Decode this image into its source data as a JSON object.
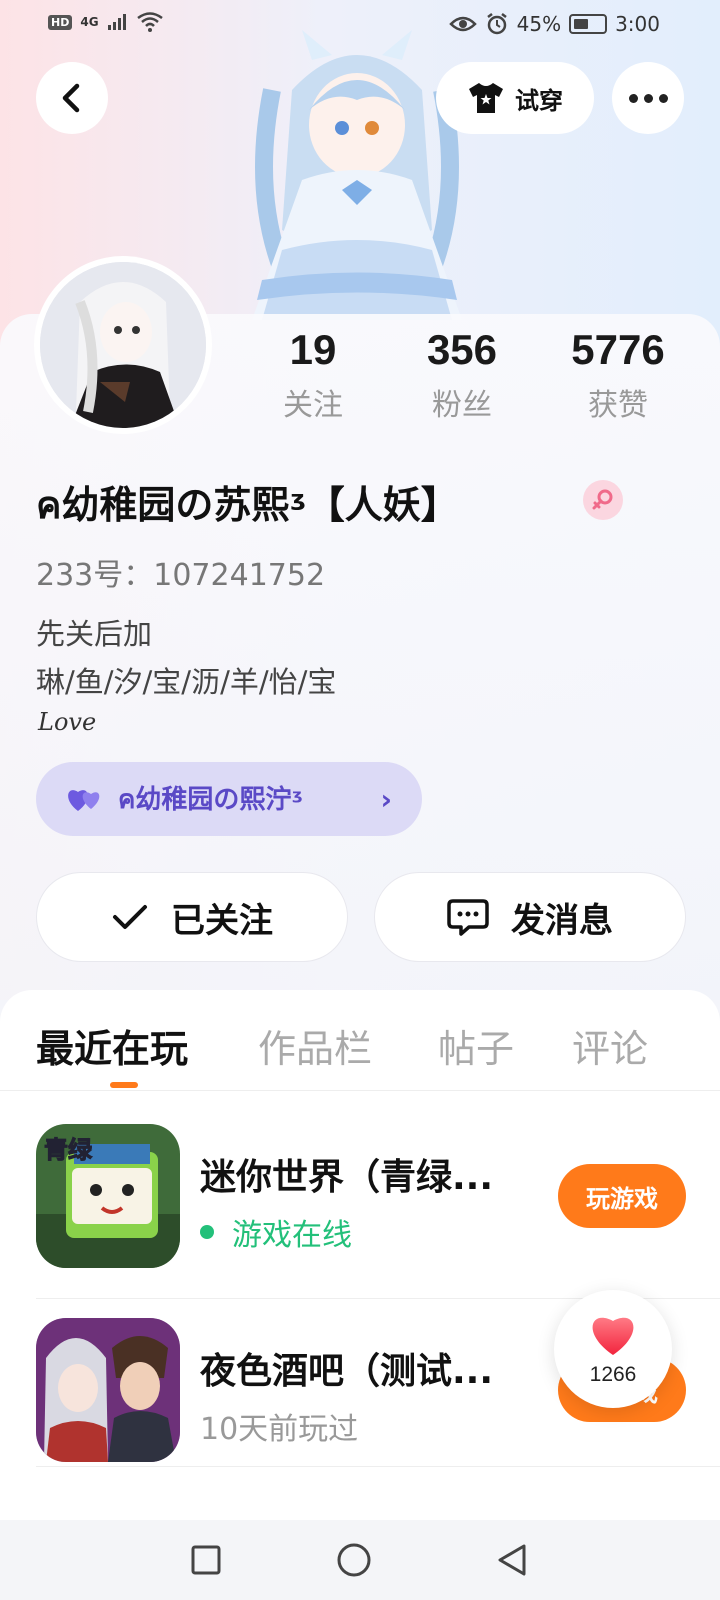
{
  "status_bar": {
    "network": "4G",
    "hd": "HD",
    "battery": "45%",
    "time": "3:00"
  },
  "header": {
    "tryon_label": "试穿"
  },
  "profile": {
    "stats": [
      {
        "value": "19",
        "label": "关注"
      },
      {
        "value": "356",
        "label": "粉丝"
      },
      {
        "value": "5776",
        "label": "获赞"
      }
    ],
    "nickname": "ค幼稚园の苏熙ᶾ【人妖】",
    "uid": "233号：107241752",
    "bio_lines": [
      "先关后加",
      "琳/鱼/汐/宝/沥/羊/怡/宝"
    ],
    "bio_sign": "Love",
    "cp_name": "ค幼稚园の熙泞ᶾ"
  },
  "actions": {
    "follow_label": "已关注",
    "message_label": "发消息"
  },
  "tabs": [
    "最近在玩",
    "作品栏",
    "帖子",
    "评论"
  ],
  "games": [
    {
      "title": "迷你世界（青绿...",
      "status": "游戏在线",
      "play_label": "玩游戏",
      "icon_text": "青绿"
    },
    {
      "title": "夜色酒吧（测试...",
      "status": "10天前玩过",
      "play_label": "玩游戏"
    }
  ],
  "like_count": "1266",
  "colors": {
    "accent": "#ff7a1a",
    "online": "#23c07a",
    "cp_text": "#5a49c6"
  }
}
